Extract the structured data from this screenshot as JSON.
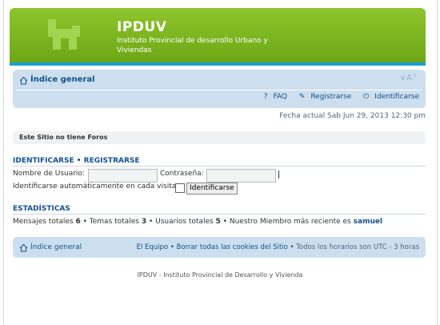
{
  "header": {
    "title": "IPDUV",
    "description": "Instituto Provincial de desarrollo Urbano y Viviendas"
  },
  "nav": {
    "index_label": "Índice general",
    "font_size_label": "∨A˄",
    "faq": "FAQ",
    "register": "Registrarse",
    "login": "Identificarse",
    "date": "Fecha actual Sab Jun 29, 2013 12:30 pm"
  },
  "notice": "Este Sitio no tiene Foros",
  "login_section": {
    "heading": "IDENTIFICARSE • REGISTRARSE",
    "username_label": "Nombre de Usuario:",
    "username_value": "",
    "password_label": "Contraseña:",
    "password_value": "",
    "remember_label": "Identificarse automáticamente en cada visita",
    "submit_label": "Identificarse"
  },
  "stats": {
    "heading": "ESTADÍSTICAS",
    "posts_label": "Mensajes totales",
    "posts": "6",
    "topics_label": "Temas totales",
    "topics": "3",
    "users_label": "Usuarios totales",
    "users": "5",
    "newest_label": "Nuestro Miembro más reciente es",
    "newest_member": "samuel"
  },
  "footer": {
    "index_label": "Índice general",
    "team": "El Equipo",
    "delete_cookies": "Borrar todas las cookies del Sitio",
    "timezone": "Todos los horarios son UTC - 3 horas",
    "copyright": "IPDUV - Instituto Provincial de Desarrollo y Vivienda"
  }
}
